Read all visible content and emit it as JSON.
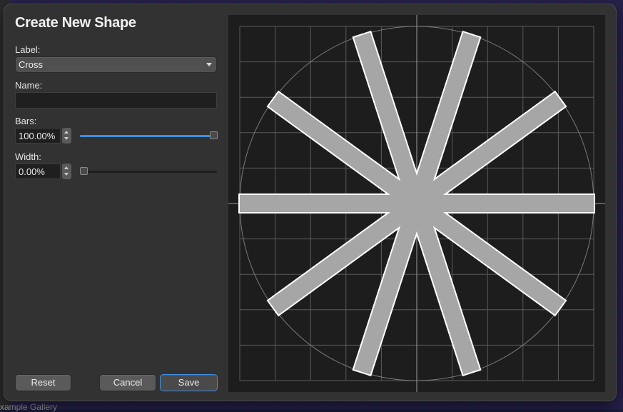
{
  "dialog": {
    "title": "Create New Shape"
  },
  "form": {
    "label": {
      "caption": "Label:",
      "selected": "Cross"
    },
    "name": {
      "caption": "Name:",
      "value": ""
    },
    "bars": {
      "caption": "Bars:",
      "value_text": "100.00%",
      "fraction": 1.0
    },
    "width": {
      "caption": "Width:",
      "value_text": "0.00%",
      "fraction": 0.0
    }
  },
  "buttons": {
    "reset": "Reset",
    "cancel": "Cancel",
    "save": "Save"
  },
  "preview": {
    "bar_count": 10,
    "bar_fill": "#a6a6a6",
    "bar_stroke": "#ffffff",
    "grid_color": "#5a5a5a"
  },
  "background": {
    "partial_text": "xample Gallery"
  },
  "colors": {
    "accent": "#3d8fe3",
    "dialog_bg": "#323232"
  }
}
